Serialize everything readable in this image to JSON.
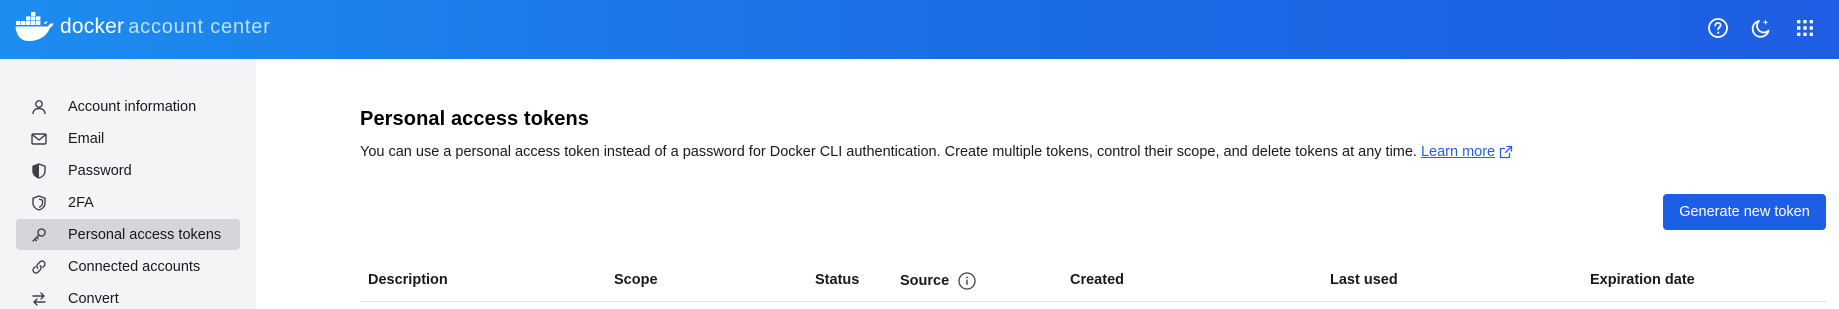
{
  "header": {
    "brand_main": "docker",
    "brand_sub": "account center",
    "icons": [
      "docker-whale-logo",
      "help-icon",
      "theme-icon",
      "apps-grid-icon"
    ]
  },
  "sidebar": {
    "items": [
      {
        "label": "Account information",
        "icon": "user-icon",
        "active": false
      },
      {
        "label": "Email",
        "icon": "mail-icon",
        "active": false
      },
      {
        "label": "Password",
        "icon": "shield-icon",
        "active": false
      },
      {
        "label": "2FA",
        "icon": "shield-outline-icon",
        "active": false
      },
      {
        "label": "Personal access tokens",
        "icon": "key-icon",
        "active": true
      },
      {
        "label": "Connected accounts",
        "icon": "link-icon",
        "active": false
      },
      {
        "label": "Convert",
        "icon": "swap-icon",
        "active": false
      }
    ]
  },
  "main": {
    "title": "Personal access tokens",
    "description": "You can use a personal access token instead of a password for Docker CLI authentication. Create multiple tokens, control their scope, and delete tokens at any time.",
    "learn_more": "Learn more",
    "generate_button": "Generate new token",
    "table": {
      "columns": [
        "Description",
        "Scope",
        "Status",
        "Source",
        "Created",
        "Last used",
        "Expiration date"
      ]
    }
  },
  "colors": {
    "header_gradient_start": "#1d8cf0",
    "header_gradient_end": "#1e5ee4",
    "primary_button": "#1c5ee6",
    "link": "#1d63ed",
    "sidebar_bg": "#f4f4f6",
    "sidebar_active": "#d5d6da"
  }
}
